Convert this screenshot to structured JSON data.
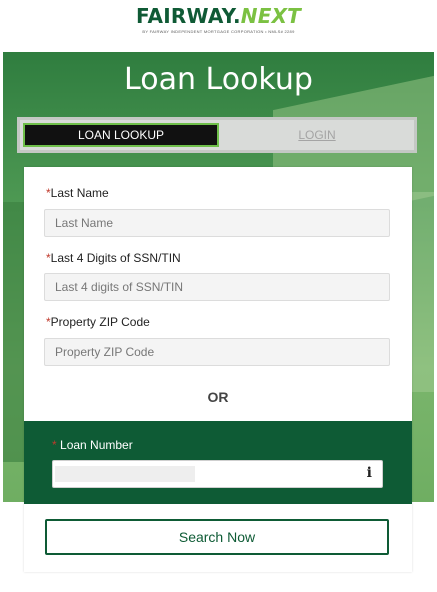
{
  "brand": {
    "name_main": "FAIRWAY.",
    "name_accent": "NEXT",
    "tagline": "BY FAIRWAY INDEPENDENT MORTGAGE CORPORATION • NMLS# 2289",
    "primary_color": "#0e5b35",
    "accent_color": "#7bc142"
  },
  "hero": {
    "title": "Loan Lookup"
  },
  "tabs": {
    "active_label": "LOAN LOOKUP",
    "login_label": "LOGIN"
  },
  "form": {
    "required_marker": "*",
    "last_name": {
      "label": "Last Name",
      "placeholder": "Last Name"
    },
    "ssn": {
      "label": "Last 4 Digits of SSN/TIN",
      "placeholder": "Last 4 digits of SSN/TIN"
    },
    "zip": {
      "label": "Property ZIP Code",
      "placeholder": "Property ZIP Code"
    },
    "or_text": "OR",
    "loan_number": {
      "label": "Loan Number",
      "info_glyph": "i"
    },
    "search_button": "Search Now"
  }
}
